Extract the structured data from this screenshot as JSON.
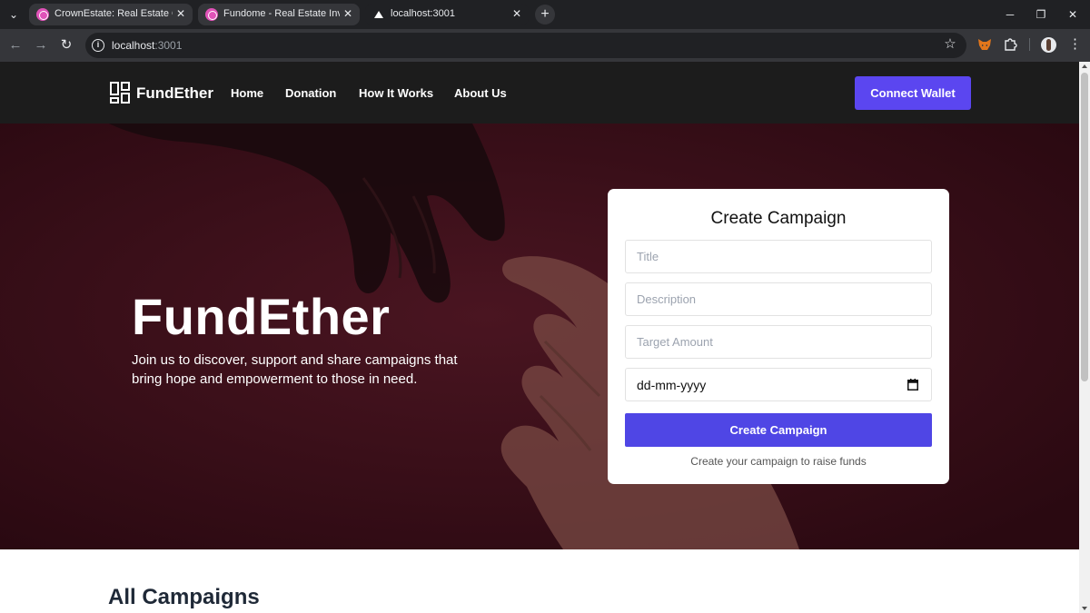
{
  "browser": {
    "tabs": [
      {
        "title": "CrownEstate: Real Estate Crowd",
        "active": false
      },
      {
        "title": "Fundome - Real Estate Investm",
        "active": false
      },
      {
        "title": "localhost:3001",
        "active": true
      }
    ],
    "url_host": "localhost",
    "url_port": ":3001"
  },
  "nav": {
    "brand": "FundEther",
    "links": [
      "Home",
      "Donation",
      "How It Works",
      "About Us"
    ],
    "connect_label": "Connect Wallet"
  },
  "hero": {
    "title": "FundEther",
    "subtitle": "Join us to discover, support and share campaigns that bring hope and empowerment to those in need."
  },
  "form": {
    "title": "Create Campaign",
    "title_placeholder": "Title",
    "description_placeholder": "Description",
    "amount_placeholder": "Target Amount",
    "date_placeholder": "dd-mm-yyyy",
    "submit_label": "Create Campaign",
    "note": "Create your campaign to raise funds"
  },
  "campaigns": {
    "heading": "All Campaigns"
  },
  "colors": {
    "accent": "#5b46f0",
    "submit": "#4f46e5",
    "hero_bg": "#3a0e19",
    "nav_bg": "#1c1c1c"
  },
  "icons": [
    "tab-list-icon",
    "back-icon",
    "forward-icon",
    "reload-icon",
    "site-info-icon",
    "bookmark-star-icon",
    "metamask-fox-icon",
    "extensions-puzzle-icon",
    "profile-avatar-icon",
    "menu-kebab-icon",
    "calendar-icon",
    "logo-icon"
  ]
}
